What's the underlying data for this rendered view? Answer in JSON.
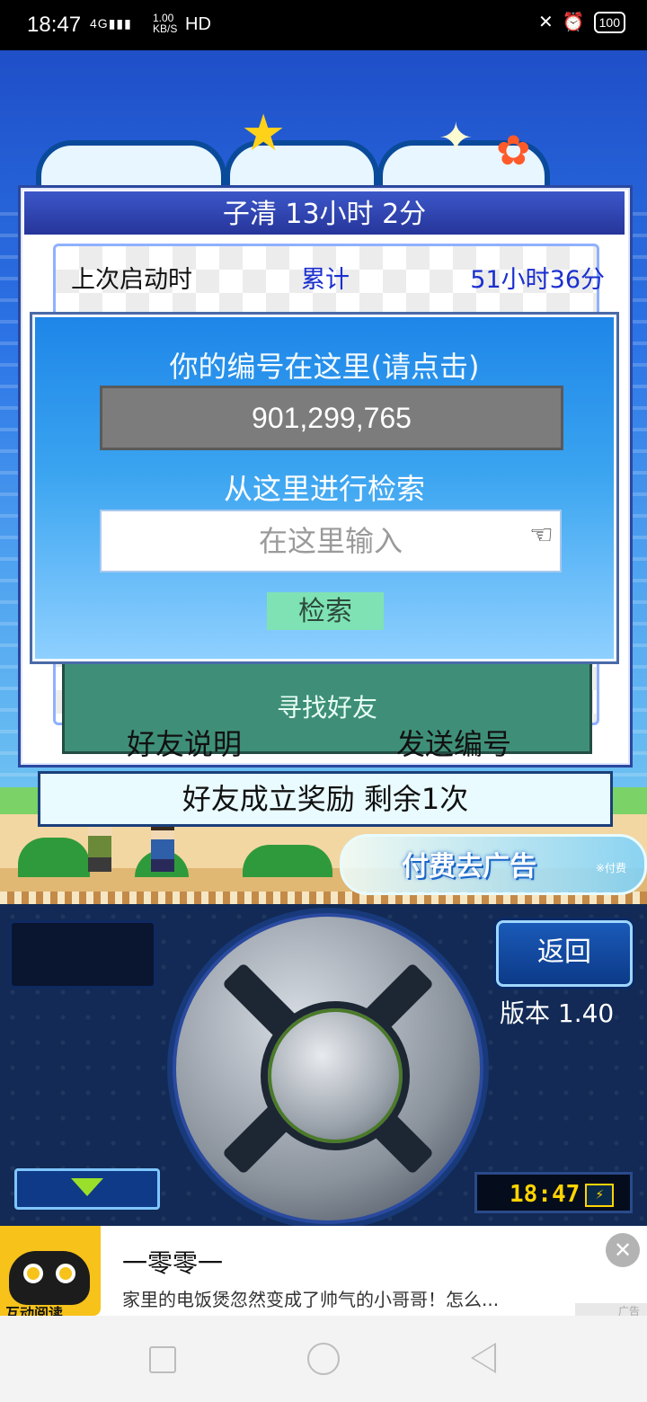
{
  "status_bar": {
    "time": "18:47",
    "network": "4G",
    "speed_value": "1.00",
    "speed_unit": "KB/S",
    "hd": "HD",
    "battery": "100"
  },
  "friend_panel": {
    "title": "子清  13小时 2分",
    "last_launch_label": "上次启动时",
    "total_label": "累计",
    "total_value": "51小时36分",
    "find_friend_button": "寻找好友",
    "friend_info_link": "好友说明",
    "send_id_link": "发送编号"
  },
  "search_dialog": {
    "title": "你的编号在这里(请点击)",
    "player_id": "901,299,765",
    "search_label": "从这里进行检索",
    "search_placeholder": "在这里输入",
    "search_button": "检索"
  },
  "reward_bar": "好友成立奖励  剩余1次",
  "remove_ads": {
    "label": "付费去广告",
    "note": "※付费"
  },
  "controls": {
    "back_button": "返回",
    "version": "版本 1.40",
    "game_clock": "18:47"
  },
  "ad_banner": {
    "app_icon_label": "互动阅读",
    "title": "一零零一",
    "description": "家里的电饭煲忽然变成了帅气的小哥哥！怎么...",
    "tag": "广告"
  },
  "colors": {
    "dialog_blue": "#1e86e8",
    "panel_title_blue": "#26359a",
    "link_blue": "#1a2fd0",
    "find_friend_green": "#3f8f78",
    "search_button_green": "#7fe2b4"
  }
}
